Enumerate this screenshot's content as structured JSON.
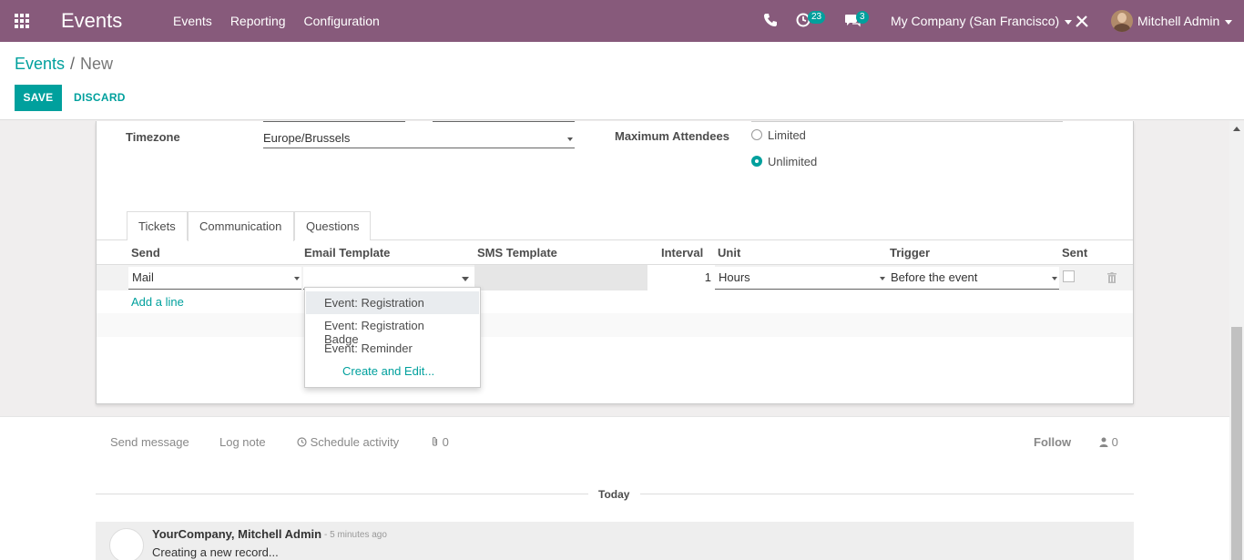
{
  "navbar": {
    "brand": "Events",
    "menu": [
      "Events",
      "Reporting",
      "Configuration"
    ],
    "activity_badge": "23",
    "chat_badge": "3",
    "company": "My Company (San Francisco)",
    "user": "Mitchell Admin",
    "color": "#875a7b"
  },
  "breadcrumb": {
    "parent": "Events",
    "separator": "/",
    "current": "New"
  },
  "buttons": {
    "save": "SAVE",
    "discard": "DISCARD"
  },
  "form": {
    "timezone_label": "Timezone",
    "timezone_value": "Europe/Brussels",
    "max_attendees_label": "Maximum Attendees",
    "limited_label": "Limited",
    "unlimited_label": "Unlimited",
    "selected_option": "Unlimited"
  },
  "tabs": [
    "Tickets",
    "Communication",
    "Questions"
  ],
  "active_tab": "Communication",
  "table": {
    "headers": {
      "send": "Send",
      "email_template": "Email Template",
      "sms_template": "SMS Template",
      "interval": "Interval",
      "unit": "Unit",
      "trigger": "Trigger",
      "sent": "Sent"
    },
    "row": {
      "send": "Mail",
      "email_template": "",
      "sms_template": "",
      "interval": "1",
      "unit": "Hours",
      "trigger": "Before the event",
      "sent": false
    },
    "add_line": "Add a line"
  },
  "dropdown": {
    "items": [
      "Event: Registration",
      "Event: Registration Badge",
      "Event: Reminder"
    ],
    "create_edit": "Create and Edit..."
  },
  "chatter": {
    "send_message": "Send message",
    "log_note": "Log note",
    "schedule_activity": "Schedule activity",
    "attachments_count": "0",
    "follow": "Follow",
    "followers_count": "0",
    "today": "Today",
    "message": {
      "author": "YourCompany, Mitchell Admin",
      "time": "- 5 minutes ago",
      "body": "Creating a new record..."
    }
  },
  "colors": {
    "accent": "#00a09d",
    "brand": "#875a7b"
  }
}
